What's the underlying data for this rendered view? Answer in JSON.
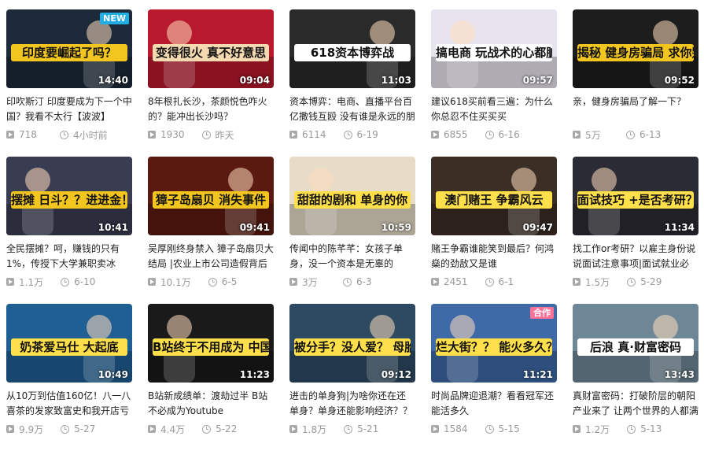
{
  "videos": [
    {
      "caption": "印度要崛起了吗？",
      "badge": "NEW",
      "duration": "14:40",
      "title": "印吹斯汀 印度要成为下一个中国？我看不太行【波波】",
      "views": "718",
      "date": "4小时前",
      "bg": "#1c2a3a",
      "capbg": "#f3c61f"
    },
    {
      "caption": "变得很火 真不好意思",
      "badge": "",
      "duration": "09:04",
      "title": "8年根扎长沙，茶颜悦色咋火的？能冲出长沙吗？",
      "views": "1930",
      "date": "昨天",
      "bg": "#b8192c",
      "capbg": "#f5d9b0"
    },
    {
      "caption": "618资本博弈战",
      "badge": "",
      "duration": "11:03",
      "title": "资本博弈：电商、直播平台百亿撒钱互殴 没有谁是永远的朋",
      "views": "6114",
      "date": "6-19",
      "bg": "#2a2a2a",
      "capbg": "#ffffff"
    },
    {
      "caption": "搞电商 玩战术的心都脏",
      "badge": "",
      "duration": "09:57",
      "title": "建议618买前看三遍：为什么你总忍不住买买买",
      "views": "6855",
      "date": "6-16",
      "bg": "#e8e4ef",
      "capbg": "#ffffff"
    },
    {
      "caption": "揭秘 健身房骗局 求你别再被骗了",
      "badge": "",
      "duration": "09:52",
      "title": "亲，健身房骗局了解一下？",
      "views": "5万",
      "date": "6-13",
      "bg": "#1d1d1d",
      "capbg": "#f3c61f"
    },
    {
      "caption": "摆摊 日斗？？进进金！！",
      "badge": "",
      "duration": "10:41",
      "title": "全民摆摊？呵，赚钱的只有1%，传授下大学兼职卖冰",
      "views": "1.1万",
      "date": "6-10",
      "bg": "#3a3d52",
      "capbg": "#f3c61f"
    },
    {
      "caption": "獐子岛扇贝 消失事件",
      "badge": "",
      "duration": "09:41",
      "title": "吴厚刚终身禁入 獐子岛扇贝大结局 |农业上市公司造假背后",
      "views": "10.1万",
      "date": "6-5",
      "bg": "#5a1a10",
      "capbg": "#f3c61f"
    },
    {
      "caption": "甜甜的剧和 单身的你",
      "badge": "",
      "duration": "10:59",
      "title": "传闻中的陈芊芊：女孩子单身，没一个资本是无辜的",
      "views": "3万",
      "date": "6-3",
      "bg": "#e6dcc8",
      "capbg": "#ffe04a"
    },
    {
      "caption": "澳门赌王 争霸风云",
      "badge": "",
      "duration": "09:47",
      "title": "赌王争霸谁能笑到最后？何鸿燊的劲敌又是谁",
      "views": "2451",
      "date": "6-1",
      "bg": "#3b2e24",
      "capbg": "#ffe04a"
    },
    {
      "caption": "面试技巧 +是否考研？？",
      "badge": "",
      "duration": "11:34",
      "title": "找工作or考研？以雇主身份说说面试注意事项|面试就业必看",
      "views": "1.5万",
      "date": "5-29",
      "bg": "#2b2b33",
      "capbg": "#ffe04a"
    },
    {
      "caption": "奶茶爱马仕 大起底",
      "badge": "",
      "duration": "10:49",
      "title": "从10万到估值160亿！八一八喜茶的发家致富史和我开店亏",
      "views": "9.9万",
      "date": "5-27",
      "bg": "#1f5f93",
      "capbg": "#ffe04a"
    },
    {
      "caption": "B站终于不用成为 中国YouTube",
      "badge": "",
      "duration": "11:23",
      "title": "B站新成绩单：渡劫过半 B站不必成为Youtube",
      "views": "4.4万",
      "date": "5-22",
      "bg": "#1a1a1a",
      "capbg": "#ffe04a"
    },
    {
      "caption": "被分手？没人爱？ 母胎solo？",
      "badge": "",
      "duration": "09:12",
      "title": "进击的单身狗|为啥你还在还单身？单身还能影响经济？？",
      "views": "1.8万",
      "date": "5-21",
      "bg": "#2e4a62",
      "capbg": "#ffe04a"
    },
    {
      "caption": "烂大街？？ 能火多久？？",
      "badge": "合作",
      "duration": "11:21",
      "title": "时尚品牌迎退潮？看看冠军还能活多久",
      "views": "1584",
      "date": "5-15",
      "bg": "#3e6aa8",
      "capbg": "#ffe04a"
    },
    {
      "caption": "后浪 真·财富密码",
      "badge": "",
      "duration": "13:43",
      "title": "真财富密码：打破阶层的朝阳产业来了 让两个世界的人都满",
      "views": "1.2万",
      "date": "5-13",
      "bg": "#6e8796",
      "capbg": "#ffffff"
    }
  ]
}
